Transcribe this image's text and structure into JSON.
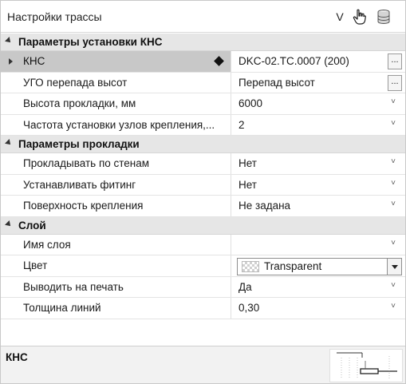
{
  "titlebar": {
    "title": "Настройки трассы",
    "v_label": "V",
    "icons": [
      "hand-pointer-icon",
      "database-icon"
    ]
  },
  "categories": [
    {
      "label": "Параметры установки КНС",
      "rows": [
        {
          "name": "КНС",
          "value": "DKC-02.TC.0007 (200)",
          "editor": "ellipsis",
          "selected": true
        },
        {
          "name": "УГО перепада высот",
          "value": "Перепад высот",
          "editor": "ellipsis"
        },
        {
          "name": "Высота прокладки, мм",
          "value": "6000",
          "editor": "dropdown"
        },
        {
          "name": "Частота установки узлов крепления,...",
          "value": "2",
          "editor": "dropdown"
        }
      ]
    },
    {
      "label": "Параметры прокладки",
      "rows": [
        {
          "name": "Прокладывать по стенам",
          "value": "Нет",
          "editor": "dropdown"
        },
        {
          "name": "Устанавливать фитинг",
          "value": "Нет",
          "editor": "dropdown"
        },
        {
          "name": "Поверхность крепления",
          "value": "Не задана",
          "editor": "dropdown"
        }
      ]
    },
    {
      "label": "Слой",
      "rows": [
        {
          "name": "Имя слоя",
          "value": "",
          "editor": "dropdown"
        },
        {
          "name": "Цвет",
          "value": "Transparent",
          "editor": "color"
        },
        {
          "name": "Выводить на печать",
          "value": "Да",
          "editor": "dropdown"
        },
        {
          "name": "Толщина линий",
          "value": "0,30",
          "editor": "dropdown"
        }
      ]
    }
  ],
  "description": {
    "title": "КНС"
  },
  "glyphs": {
    "ellipsis": "...",
    "chevron": "˅"
  }
}
